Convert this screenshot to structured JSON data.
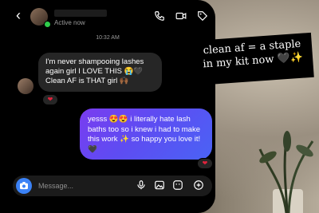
{
  "header": {
    "back_icon": "chevron-left-icon",
    "status": "Active now",
    "icons": [
      "phone-icon",
      "video-icon",
      "tag-icon"
    ]
  },
  "timestamp": "10:32 AM",
  "messages": [
    {
      "from": "them",
      "text": "I'm never shampooing lashes again girl I LOVE THIS 😭🖤 Clean AF is THAT girl 🙌🏾",
      "reaction": "❤"
    },
    {
      "from": "me",
      "text": "yesss 😍😍 i literally hate lash baths too so i knew i had to make this work ✨ so happy you love it! 🖤",
      "reaction": "❤"
    }
  ],
  "composer": {
    "placeholder": "Message...",
    "icons": [
      "camera-icon",
      "microphone-icon",
      "image-icon",
      "sticker-icon",
      "plus-icon"
    ]
  },
  "overlay_caption": "clean af = a staple in my kit now 🖤✨",
  "colors": {
    "accent_blue": "#3b82f6",
    "bubble_gradient_start": "#7a3cf0",
    "bubble_gradient_end": "#4a63f5",
    "online_green": "#2fcc4b"
  }
}
